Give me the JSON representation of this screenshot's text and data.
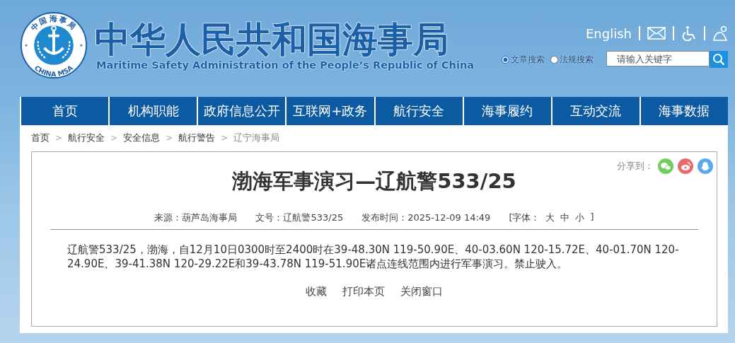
{
  "header": {
    "logo": {
      "ring_text": "中国海事局",
      "bottom_text": "CHINA MSA"
    },
    "title": "中华人民共和国海事局",
    "subtitle": "Maritime Safety Administration of the People’s Republic of China",
    "language_link": "English",
    "search_modes": [
      {
        "label": "文章搜索",
        "selected": true
      },
      {
        "label": "法规搜索",
        "selected": false
      }
    ],
    "search": {
      "placeholder": "请输入关键字"
    }
  },
  "nav": [
    "首页",
    "机构职能",
    "政府信息公开",
    "互联网+政务",
    "航行安全",
    "海事履约",
    "互动交流",
    "海事数据"
  ],
  "breadcrumb": {
    "separator": ">",
    "items": [
      {
        "label": "首页",
        "current": false
      },
      {
        "label": "航行安全",
        "current": false
      },
      {
        "label": "安全信息",
        "current": false
      },
      {
        "label": "航行警告",
        "current": false
      },
      {
        "label": "辽宁海事局",
        "current": true
      }
    ]
  },
  "article": {
    "share_label": "分享到：",
    "title": "渤海军事演习—辽航警533/25",
    "meta": [
      {
        "kind": "text",
        "text": "来源：葫芦岛海事局"
      },
      {
        "kind": "text",
        "text": "文号：辽航警533/25"
      },
      {
        "kind": "text",
        "text": "发布时间：2025-12-09 14:49"
      },
      {
        "kind": "font",
        "label": "[字体：",
        "options": [
          "大",
          "中",
          "小"
        ],
        "end": "]"
      }
    ],
    "body": "辽航警533/25，渤海，自12月10日0300时至2400时在39-48.30N 119-50.90E、40-03.60N 120-15.72E、40-01.70N 120-24.90E、39-41.38N 120-29.22E和39-43.78N 119-51.90E诸点连线范围内进行军事演习。禁止驶入。",
    "actions": [
      "收藏",
      "打印本页",
      "关闭窗口"
    ]
  }
}
